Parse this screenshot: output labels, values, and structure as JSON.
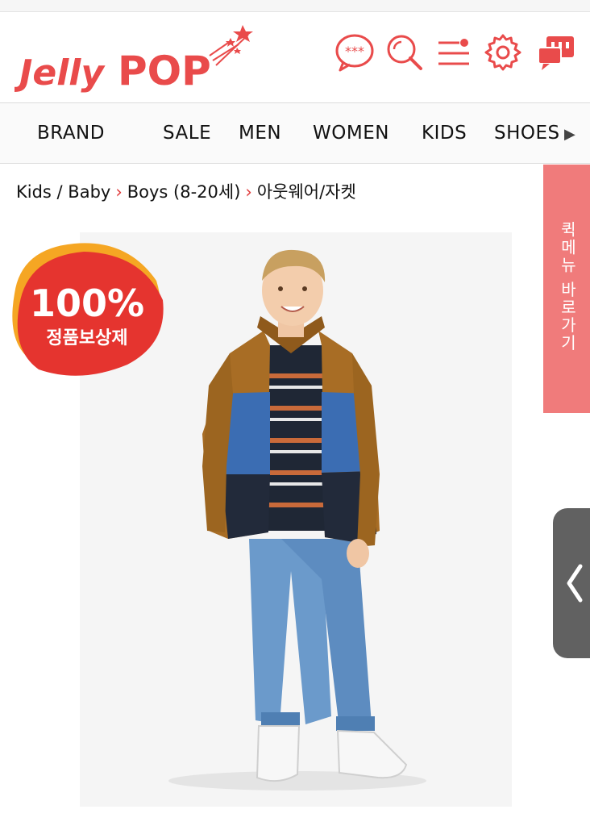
{
  "brand": {
    "logo_text": "Jelly POP",
    "accent_color": "#e94b4b",
    "secondary_color": "#f07b7b"
  },
  "header_icons": [
    "chat-bubble-icon",
    "search-icon",
    "menu-icon",
    "gear-icon",
    "customer-service-icon"
  ],
  "nav": {
    "items": [
      "BRAND",
      "SALE",
      "MEN",
      "WOMEN",
      "KIDS",
      "SHOES"
    ]
  },
  "breadcrumb": {
    "items": [
      "Kids / Baby",
      "Boys (8-20세)",
      "아웃웨어/자켓"
    ]
  },
  "badge": {
    "big": "100%",
    "small": "정품보상제"
  },
  "side_tab": {
    "label": "퀵메뉴 바로가기"
  }
}
